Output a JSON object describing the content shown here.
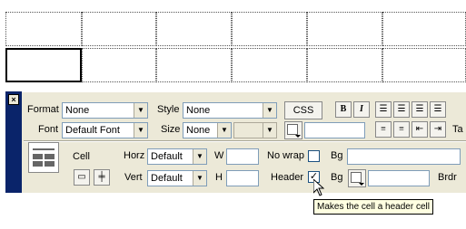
{
  "inspector": {
    "close_label": "×",
    "format_label": "Format",
    "format_value": "None",
    "style_label": "Style",
    "style_value": "None",
    "css_button": "CSS",
    "bold_button": "B",
    "italic_button": "I",
    "font_label": "Font",
    "font_value": "Default Font",
    "size_label": "Size",
    "size_value": "None",
    "target_label": "Ta",
    "cell_label": "Cell",
    "horz_label": "Horz",
    "horz_value": "Default",
    "vert_label": "Vert",
    "vert_value": "Default",
    "w_label": "W",
    "h_label": "H",
    "nowrap_label": "No wrap",
    "header_label": "Header",
    "header_checked": "✓",
    "bg_label_1": "Bg",
    "bg_label_2": "Bg",
    "brdr_label": "Brdr"
  },
  "tooltip": {
    "text": "Makes the cell a header cell"
  }
}
